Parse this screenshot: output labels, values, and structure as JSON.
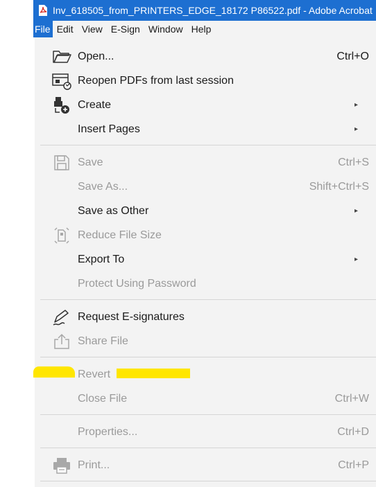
{
  "window": {
    "title": "Inv_618505_from_PRINTERS_EDGE_18172 P86522.pdf - Adobe Acrobat"
  },
  "menubar": {
    "items": [
      "File",
      "Edit",
      "View",
      "E-Sign",
      "Window",
      "Help"
    ],
    "active": "File"
  },
  "menu": {
    "open": {
      "label": "Open...",
      "shortcut": "Ctrl+O",
      "icon": "folder-open-icon"
    },
    "reopen": {
      "label": "Reopen PDFs from last session",
      "icon": "reopen-session-icon"
    },
    "create": {
      "label": "Create",
      "icon": "create-pdf-icon",
      "arrow": "▸"
    },
    "insert_pages": {
      "label": "Insert Pages",
      "arrow": "▸"
    },
    "save": {
      "label": "Save",
      "shortcut": "Ctrl+S",
      "icon": "save-disk-icon"
    },
    "save_as": {
      "label": "Save As...",
      "shortcut": "Shift+Ctrl+S"
    },
    "save_as_other": {
      "label": "Save as Other",
      "arrow": "▸"
    },
    "reduce_size": {
      "label": "Reduce File Size",
      "icon": "reduce-size-icon"
    },
    "export_to": {
      "label": "Export To",
      "arrow": "▸"
    },
    "protect": {
      "label": "Protect Using Password"
    },
    "request_esign": {
      "label": "Request E-signatures",
      "icon": "esign-pen-icon"
    },
    "share": {
      "label": "Share File",
      "icon": "share-icon"
    },
    "revert": {
      "label": "Revert"
    },
    "close": {
      "label": "Close File",
      "shortcut": "Ctrl+W"
    },
    "properties": {
      "label": "Properties...",
      "shortcut": "Ctrl+D"
    },
    "print": {
      "label": "Print...",
      "shortcut": "Ctrl+P",
      "icon": "printer-icon"
    }
  },
  "colors": {
    "accent": "#1d6fd1",
    "menu_bg": "#f3f3f3",
    "disabled_text": "#9a9a9a",
    "highlight": "#ffe600"
  }
}
